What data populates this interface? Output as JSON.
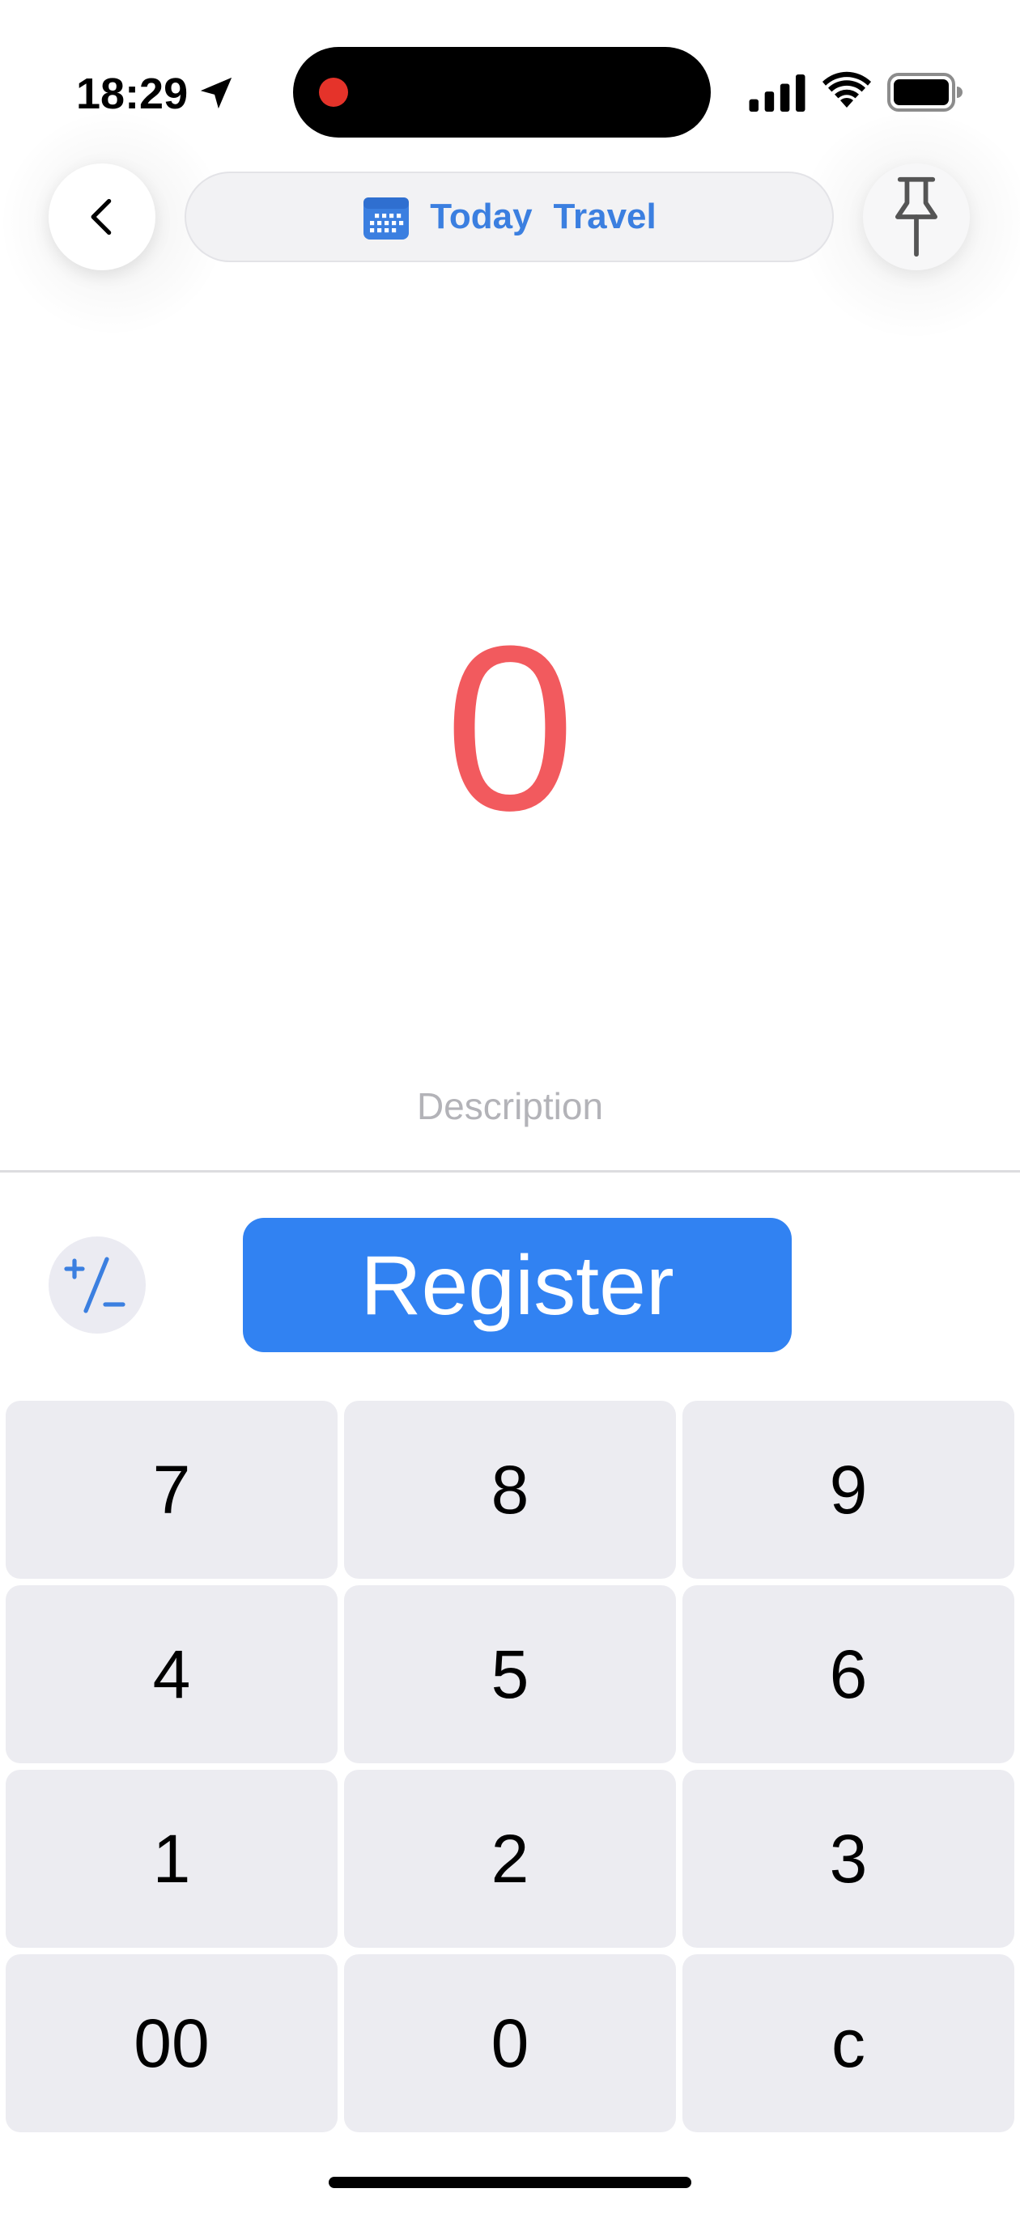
{
  "status_bar": {
    "time": "18:29",
    "icons": [
      "location-arrow-icon",
      "recording-dot-icon",
      "cellular-signal-icon",
      "wifi-icon",
      "battery-icon"
    ]
  },
  "header": {
    "back_icon": "chevron-left-icon",
    "date_icon": "calendar-icon",
    "date_label": "Today",
    "category_label": "Travel",
    "pin_icon": "pushpin-icon"
  },
  "entry": {
    "amount": "0",
    "description_placeholder": "Description"
  },
  "actions": {
    "sign_icon": "plus-minus-icon",
    "register_label": "Register"
  },
  "keypad": {
    "keys": [
      "7",
      "8",
      "9",
      "4",
      "5",
      "6",
      "1",
      "2",
      "3",
      "00",
      "0",
      "c"
    ]
  },
  "colors": {
    "accent": "#3182f2",
    "pill_text": "#3b7fe0",
    "amount": "#f25a5e",
    "key_background": "#ececf1",
    "placeholder": "#b3b3b8"
  }
}
